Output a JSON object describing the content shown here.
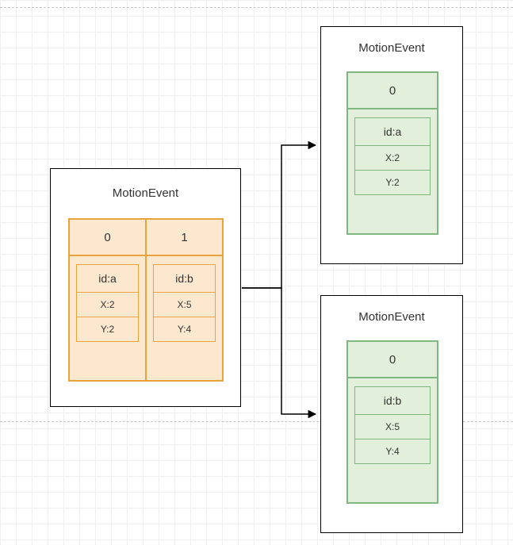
{
  "source": {
    "title": "MotionEvent",
    "columns": [
      {
        "index": "0",
        "pointer": {
          "id": "id:a",
          "x": "X:2",
          "y": "Y:2"
        }
      },
      {
        "index": "1",
        "pointer": {
          "id": "id:b",
          "x": "X:5",
          "y": "Y:4"
        }
      }
    ]
  },
  "targets": [
    {
      "title": "MotionEvent",
      "index": "0",
      "pointer": {
        "id": "id:a",
        "x": "X:2",
        "y": "Y:2"
      }
    },
    {
      "title": "MotionEvent",
      "index": "0",
      "pointer": {
        "id": "id:b",
        "x": "X:5",
        "y": "Y:4"
      }
    }
  ]
}
